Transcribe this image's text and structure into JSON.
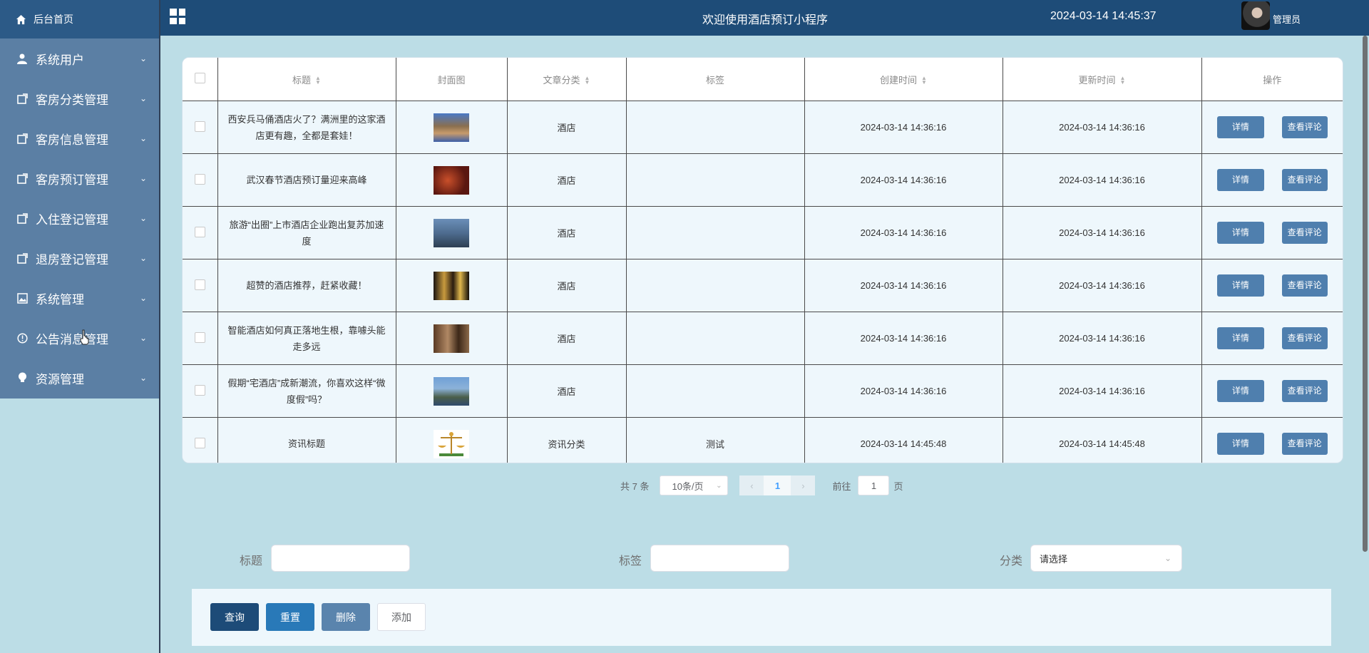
{
  "sidebar": {
    "home": "后台首页",
    "items": [
      {
        "label": "系统用户",
        "icon": "user-icon"
      },
      {
        "label": "客房分类管理",
        "icon": "edit-icon"
      },
      {
        "label": "客房信息管理",
        "icon": "edit-icon"
      },
      {
        "label": "客房预订管理",
        "icon": "edit-icon"
      },
      {
        "label": "入住登记管理",
        "icon": "edit-icon"
      },
      {
        "label": "退房登记管理",
        "icon": "edit-icon"
      },
      {
        "label": "系统管理",
        "icon": "picture-icon"
      },
      {
        "label": "公告消息管理",
        "icon": "info-icon"
      },
      {
        "label": "资源管理",
        "icon": "bulb-icon"
      }
    ]
  },
  "header": {
    "title": "欢迎使用酒店预订小程序",
    "datetime": "2024-03-14 14:45:37",
    "user": "管理员"
  },
  "table": {
    "columns": [
      "标题",
      "封面图",
      "文章分类",
      "标签",
      "创建时间",
      "更新时间",
      "操作"
    ],
    "detail_label": "详情",
    "comment_label": "查看评论",
    "rows": [
      {
        "title": "西安兵马俑酒店火了？满洲里的这家酒店更有趣，全都是套娃！",
        "category": "酒店",
        "tag": "",
        "created": "2024-03-14 14:36:16",
        "updated": "2024-03-14 14:36:16"
      },
      {
        "title": "武汉春节酒店预订量迎来高峰",
        "category": "酒店",
        "tag": "",
        "created": "2024-03-14 14:36:16",
        "updated": "2024-03-14 14:36:16"
      },
      {
        "title": "旅游“出圈”上市酒店企业跑出复苏加速度",
        "category": "酒店",
        "tag": "",
        "created": "2024-03-14 14:36:16",
        "updated": "2024-03-14 14:36:16"
      },
      {
        "title": "超赞的酒店推荐，赶紧收藏！",
        "category": "酒店",
        "tag": "",
        "created": "2024-03-14 14:36:16",
        "updated": "2024-03-14 14:36:16"
      },
      {
        "title": "智能酒店如何真正落地生根，靠噱头能走多远",
        "category": "酒店",
        "tag": "",
        "created": "2024-03-14 14:36:16",
        "updated": "2024-03-14 14:36:16"
      },
      {
        "title": "假期“宅酒店”成新潮流，你喜欢这样“微度假”吗？",
        "category": "酒店",
        "tag": "",
        "created": "2024-03-14 14:36:16",
        "updated": "2024-03-14 14:36:16"
      },
      {
        "title": "资讯标题",
        "category": "资讯分类",
        "tag": "测试",
        "created": "2024-03-14 14:45:48",
        "updated": "2024-03-14 14:45:48"
      }
    ]
  },
  "pagination": {
    "total": "共 7 条",
    "page_size": "10条/页",
    "current": "1",
    "goto_prefix": "前往",
    "goto_value": "1",
    "goto_suffix": "页"
  },
  "search": {
    "title_label": "标题",
    "tag_label": "标签",
    "category_label": "分类",
    "category_placeholder": "请选择"
  },
  "actions": {
    "query": "查询",
    "reset": "重置",
    "delete": "删除",
    "add": "添加"
  }
}
